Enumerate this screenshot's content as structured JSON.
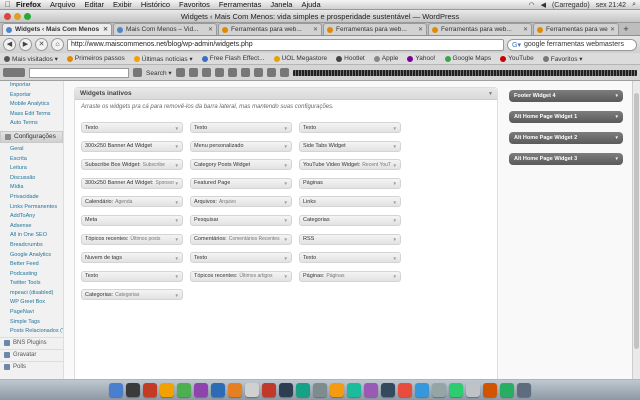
{
  "menubar": {
    "app": "Firefox",
    "items": [
      "Arquivo",
      "Editar",
      "Exibir",
      "Histórico",
      "Favoritos",
      "Ferramentas",
      "Janela",
      "Ajuda"
    ],
    "status": "(Carregado)",
    "clock": "sex 21:42"
  },
  "window": {
    "title": "Widgets ‹ Mais Com Menos: vida simples e prosperidade sustentável — WordPress"
  },
  "tabs": [
    {
      "label": "Widgets ‹ Mais Com Menos ..."
    },
    {
      "label": "Mais Com Menos – Vid..."
    },
    {
      "label": "Ferramentas para web..."
    },
    {
      "label": "Ferramentas para web..."
    },
    {
      "label": "Ferramentas para web..."
    },
    {
      "label": "Ferramentas para web..."
    }
  ],
  "nav": {
    "url": "http://www.maiscommenos.net/blog/wp-admin/widgets.php",
    "search": "google ferramentas webmasters"
  },
  "bookmarks": [
    {
      "label": "Mais visitados ▾",
      "color": "#555555"
    },
    {
      "label": "Primeiros passos",
      "color": "#e08a00"
    },
    {
      "label": "Últimas notícias ▾",
      "color": "#f2a100"
    },
    {
      "label": "Free Flash Effect...",
      "color": "#3a6fc4"
    },
    {
      "label": "UOL Megastore",
      "color": "#e4a200"
    },
    {
      "label": "Hootlet",
      "color": "#444444"
    },
    {
      "label": "Apple",
      "color": "#888888"
    },
    {
      "label": "Yahoo!",
      "color": "#7b0099"
    },
    {
      "label": "Google Maps",
      "color": "#3aa54a"
    },
    {
      "label": "YouTube",
      "color": "#cc0000"
    },
    {
      "label": "Favoritos ▾",
      "color": "#777777"
    }
  ],
  "toolbar2": {
    "search_label": "Search ▾"
  },
  "admin_menu": {
    "links_top": [
      "Importar",
      "Exportar",
      "Mobile Analytics",
      "Mass Edit Terms",
      "Auto Terms"
    ],
    "section": "Configurações",
    "links": [
      "Geral",
      "Escrita",
      "Leitura",
      "Discussão",
      "Mídia",
      "Privacidade",
      "Links Permanentes",
      "AddToAny",
      "Adsense",
      "All in One SEO",
      "Breadcrumbs",
      "Google Analytics",
      "Better Feed",
      "Podcasting",
      "Twitter Tools",
      "mpeaci (disabled)",
      "WP Greet Box",
      "PageNavi",
      "Simple Tags",
      "Posts Relacionados (YARPP)"
    ],
    "bottom": [
      "BNS Plugins",
      "Gravatar",
      "Polls"
    ]
  },
  "inactive": {
    "title": "Widgets inativos",
    "desc": "Arraste os widgets pra cá para removê-los da barra lateral, mas mantendo suas configurações."
  },
  "widgets": [
    {
      "name": "Texto",
      "sub": ""
    },
    {
      "name": "Texto",
      "sub": ""
    },
    {
      "name": "Texto",
      "sub": ""
    },
    {
      "name": "300x250 Banner Ad Widget",
      "sub": ""
    },
    {
      "name": "Menu personalizado",
      "sub": ""
    },
    {
      "name": "Side Tabs Widget",
      "sub": ""
    },
    {
      "name": "Subscribe Box Widget:",
      "sub": "Subscribe"
    },
    {
      "name": "Category Posts Widget",
      "sub": ""
    },
    {
      "name": "YouTube Video Widget:",
      "sub": "Recent YouT"
    },
    {
      "name": "300x250 Banner Ad Widget:",
      "sub": "Sponsor"
    },
    {
      "name": "Featured Page",
      "sub": ""
    },
    {
      "name": "Páginas",
      "sub": ""
    },
    {
      "name": "Calendário:",
      "sub": "Agenda"
    },
    {
      "name": "Arquivos:",
      "sub": "Arquivo"
    },
    {
      "name": "Links",
      "sub": ""
    },
    {
      "name": "Meta",
      "sub": ""
    },
    {
      "name": "Pesquisar",
      "sub": ""
    },
    {
      "name": "Categorias",
      "sub": ""
    },
    {
      "name": "Tópicos recentes:",
      "sub": "Últimos posts"
    },
    {
      "name": "Comentários:",
      "sub": "Comentários Recentes"
    },
    {
      "name": "RSS",
      "sub": ""
    },
    {
      "name": "Nuvem de tags",
      "sub": ""
    },
    {
      "name": "Texto",
      "sub": ""
    },
    {
      "name": "Texto",
      "sub": ""
    },
    {
      "name": "Texto",
      "sub": ""
    },
    {
      "name": "Tópicos recentes:",
      "sub": "Últimos artigos"
    },
    {
      "name": "Páginas:",
      "sub": "Páginas"
    },
    {
      "name": "Categorias:",
      "sub": "Categorias"
    }
  ],
  "sidebars": [
    "Footer Widget 4",
    "Alt Home Page Widget 1",
    "Alt Home Page Widget 2",
    "Alt Home Page Widget 3"
  ],
  "dock_colors": [
    "#4a7fd0",
    "#3a3a3a",
    "#c23b22",
    "#f2a100",
    "#4caf50",
    "#8e44ad",
    "#2d6bb5",
    "#e67e22",
    "#d0d0d0",
    "#c0392b",
    "#2c3e50",
    "#16a085",
    "#7f8c8d",
    "#f39c12",
    "#1abc9c",
    "#9b59b6",
    "#34495e",
    "#e74c3c",
    "#3498db",
    "#95a5a6",
    "#2ecc71",
    "#bdc3c7",
    "#d35400",
    "#27ae60",
    "#5d6d7e"
  ]
}
